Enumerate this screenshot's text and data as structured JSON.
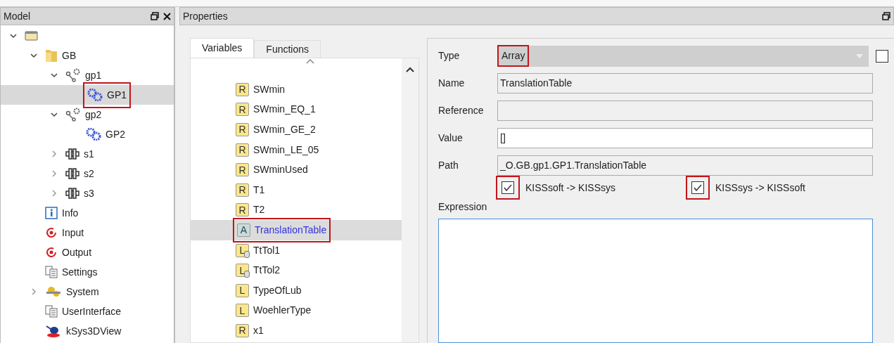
{
  "model_panel": {
    "title": "Model",
    "tree": [
      {
        "kind": "root",
        "expanded": true,
        "selected": false,
        "highlighted": false,
        "children": [
          {
            "kind": "folder",
            "label": "GB",
            "expanded": true,
            "selected": false,
            "highlighted": false,
            "children": [
              {
                "kind": "gearpair",
                "label": "gp1",
                "expanded": true,
                "selected": false,
                "highlighted": false,
                "children": [
                  {
                    "kind": "gears",
                    "label": "GP1",
                    "selected": true,
                    "highlighted": true
                  }
                ]
              },
              {
                "kind": "gearpair",
                "label": "gp2",
                "expanded": true,
                "selected": false,
                "highlighted": false,
                "children": [
                  {
                    "kind": "gears",
                    "label": "GP2",
                    "selected": false,
                    "highlighted": false
                  }
                ]
              },
              {
                "kind": "shaft",
                "label": "s1",
                "expanded": false,
                "selected": false,
                "highlighted": false
              },
              {
                "kind": "shaft",
                "label": "s2",
                "expanded": false,
                "selected": false,
                "highlighted": false
              },
              {
                "kind": "shaft",
                "label": "s3",
                "expanded": false,
                "selected": false,
                "highlighted": false
              }
            ]
          },
          {
            "kind": "info",
            "label": "Info",
            "selected": false,
            "highlighted": false
          },
          {
            "kind": "io",
            "label": "Input",
            "selected": false,
            "highlighted": false
          },
          {
            "kind": "io",
            "label": "Output",
            "selected": false,
            "highlighted": false
          },
          {
            "kind": "settings",
            "label": "Settings",
            "selected": false,
            "highlighted": false
          },
          {
            "kind": "system",
            "label": "System",
            "expanded": false,
            "selected": false,
            "highlighted": false
          },
          {
            "kind": "settings",
            "label": "UserInterface",
            "selected": false,
            "highlighted": false
          },
          {
            "kind": "view",
            "label": "kSys3DView",
            "selected": false,
            "highlighted": false
          }
        ]
      }
    ]
  },
  "properties_panel": {
    "title": "Properties",
    "tabs": [
      {
        "label": "Variables",
        "selected": true
      },
      {
        "label": "Functions",
        "selected": false
      }
    ],
    "variables": [
      {
        "badge": "R",
        "kind": "plain",
        "name": "SWmin",
        "selected": false,
        "highlighted": false
      },
      {
        "badge": "R",
        "kind": "plain",
        "name": "SWmin_EQ_1",
        "selected": false,
        "highlighted": false
      },
      {
        "badge": "R",
        "kind": "plain",
        "name": "SWmin_GE_2",
        "selected": false,
        "highlighted": false
      },
      {
        "badge": "R",
        "kind": "plain",
        "name": "SWmin_LE_05",
        "selected": false,
        "highlighted": false
      },
      {
        "badge": "R",
        "kind": "plain",
        "name": "SWminUsed",
        "selected": false,
        "highlighted": false
      },
      {
        "badge": "R",
        "kind": "plain",
        "name": "T1",
        "selected": false,
        "highlighted": false
      },
      {
        "badge": "R",
        "kind": "plain",
        "name": "T2",
        "selected": false,
        "highlighted": false
      },
      {
        "badge": "A",
        "kind": "array",
        "name": "TranslationTable",
        "selected": true,
        "highlighted": true
      },
      {
        "badge": "L",
        "kind": "table",
        "name": "TtTol1",
        "selected": false,
        "highlighted": false
      },
      {
        "badge": "L",
        "kind": "table",
        "name": "TtTol2",
        "selected": false,
        "highlighted": false
      },
      {
        "badge": "L",
        "kind": "plain",
        "name": "TypeOfLub",
        "selected": false,
        "highlighted": false
      },
      {
        "badge": "L",
        "kind": "plain",
        "name": "WoehlerType",
        "selected": false,
        "highlighted": false
      },
      {
        "badge": "R",
        "kind": "plain",
        "name": "x1",
        "selected": false,
        "highlighted": false
      }
    ],
    "fields": [
      {
        "label": "Type",
        "kind": "dropdown",
        "value": "Array",
        "readonly": true,
        "highlighted": true
      },
      {
        "label": "Name",
        "kind": "text",
        "value": "TranslationTable",
        "readonly": true,
        "highlighted": false
      },
      {
        "label": "Reference",
        "kind": "text",
        "readonly": true,
        "highlighted": false
      },
      {
        "label": "Value",
        "kind": "text",
        "value": "[]",
        "readonly": false,
        "highlighted": false
      },
      {
        "label": "Path",
        "kind": "text",
        "value": "_O.GB.gp1.GP1.TranslationTable",
        "readonly": true,
        "highlighted": false
      }
    ],
    "type_checkbox": {
      "checked": false
    },
    "sync_options": [
      {
        "label": "KISSsoft -> KISSsys",
        "checked": true,
        "highlighted": true
      },
      {
        "label": "KISSsys -> KISSsoft",
        "checked": true,
        "highlighted": true
      }
    ],
    "expression": {
      "label": "Expression"
    }
  }
}
